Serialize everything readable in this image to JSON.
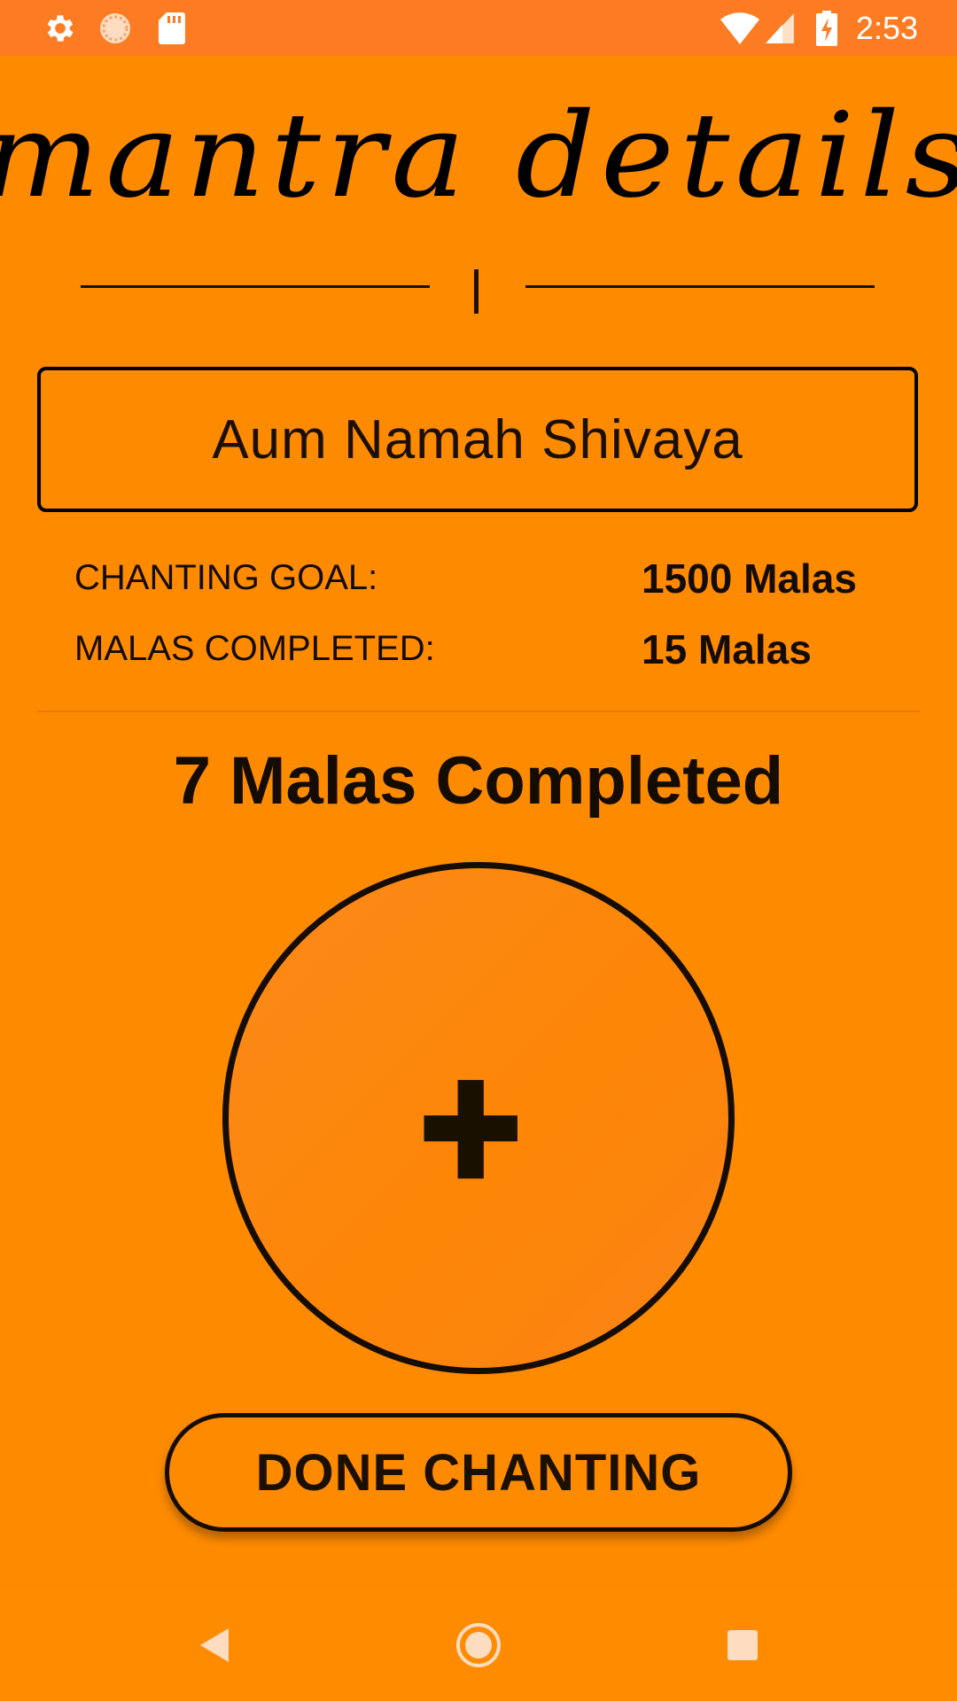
{
  "status_bar": {
    "time": "2:53",
    "icons": [
      "settings-icon",
      "sync-icon",
      "sd-card-icon",
      "wifi-icon",
      "signal-icon",
      "battery-charging-icon"
    ]
  },
  "page": {
    "title": "mantra details"
  },
  "mantra": {
    "name": "Aum Namah Shivaya"
  },
  "stats": {
    "goal_label": "CHANTING GOAL:",
    "goal_value": "1500 Malas",
    "completed_label": "MALAS COMPLETED:",
    "completed_value": "15 Malas"
  },
  "session": {
    "completed_text": "7 Malas Completed"
  },
  "actions": {
    "increment_icon": "plus-icon",
    "done_label": "DONE CHANTING"
  },
  "nav_bar": {
    "icons": [
      "back-icon",
      "home-icon",
      "recents-icon"
    ]
  },
  "colors": {
    "background": "#fe8a00",
    "status_bar": "#fd7b23",
    "text": "#140c00"
  }
}
